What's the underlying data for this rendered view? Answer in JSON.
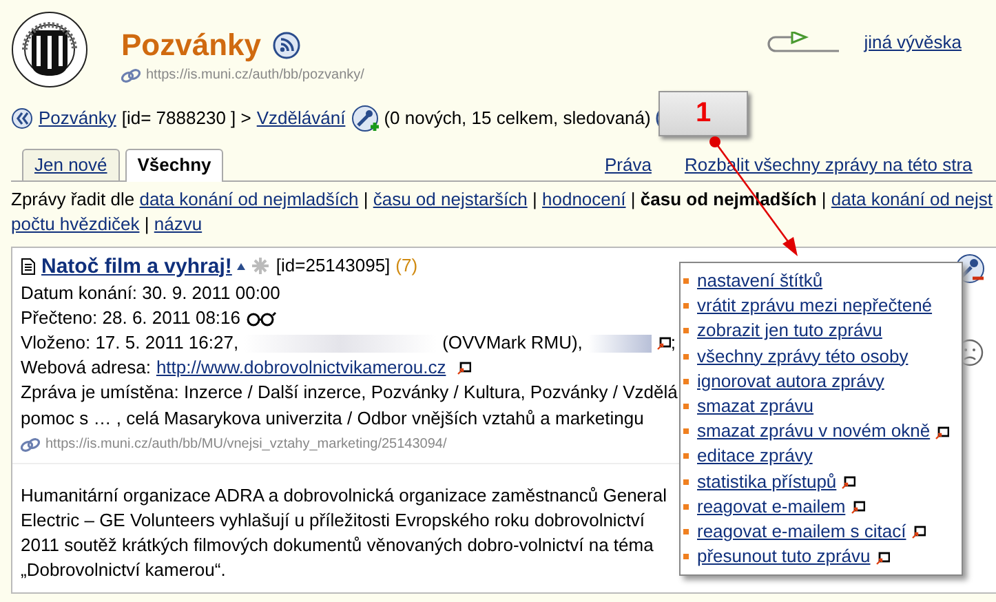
{
  "header": {
    "title": "Pozvánky",
    "url": "https://is.muni.cz/auth/bb/pozvanky/",
    "other_board_link": "jiná vývěska"
  },
  "breadcrumb": {
    "parent_link": "Pozvánky",
    "id_text": "[id= 7888230 ] >",
    "current_link": "Vzdělávání",
    "stats": "(0 nových, 15 celkem, sledovaná)"
  },
  "callout": {
    "number": "1"
  },
  "tabs": [
    {
      "label": "Jen nové",
      "selected": false
    },
    {
      "label": "Všechny",
      "selected": true
    }
  ],
  "top_links": [
    "Práva",
    "Rozbalit všechny zprávy na této stra"
  ],
  "sort": {
    "label": "Zprávy řadit dle",
    "separator": "|",
    "lines": [
      [
        {
          "label": "data konání od nejmladších",
          "selected": false
        },
        {
          "label": "času od nejstarších",
          "selected": false
        },
        {
          "label": "hodnocení",
          "selected": false
        },
        {
          "label": "času od nejmladších",
          "selected": true
        },
        {
          "label": "data konání od nejst",
          "selected": false
        }
      ],
      [
        {
          "label": "počtu hvězdiček",
          "selected": false
        },
        {
          "label": "názvu",
          "selected": false
        }
      ]
    ]
  },
  "message": {
    "title": "Natoč film a vyhraj!",
    "id": "[id=25143095]",
    "count": "(7)",
    "event_date": "Datum konání: 30. 9. 2011 00:00",
    "read": "Přečteno: 28. 6. 2011 08:16",
    "posted_prefix": "Vloženo: 17. 5. 2011 16:27,",
    "posted_org": "(OVVMark RMU),",
    "posted_suffix": ";",
    "web_label": "Webová adresa:",
    "web_link": "http://www.dobrovolnictvikamerou.cz",
    "placement_lines": [
      "Zpráva je umístěna: Inzerce / Další inzerce, Pozvánky / Kultura, Pozvánky / Vzdělá",
      "pomoc s … , celá Masarykova univerzita / Odbor vnějších vztahů a marketingu"
    ],
    "url": "https://is.muni.cz/auth/bb/MU/vnejsi_vztahy_marketing/25143094/",
    "body": "Humanitární organizace ADRA a dobrovolnická organizace zaměstnanců General Electric – GE Volunteers vyhlašují u příležitosti Evropského roku dobrovolnictví 2011 soutěž krátkých filmových dokumentů věnovaných dobro-volnictví na téma „Dobrovolnictví kamerou“."
  },
  "menu": [
    {
      "label": "nastavení štítků",
      "new_window": false
    },
    {
      "label": "vrátit zprávu mezi nepřečtené",
      "new_window": false
    },
    {
      "label": "zobrazit jen tuto zprávu",
      "new_window": false
    },
    {
      "label": "všechny zprávy této osoby",
      "new_window": false
    },
    {
      "label": "ignorovat autora zprávy",
      "new_window": false
    },
    {
      "label": "smazat zprávu",
      "new_window": false
    },
    {
      "label": "smazat zprávu v novém okně",
      "new_window": true
    },
    {
      "label": "editace zprávy",
      "new_window": false
    },
    {
      "label": "statistika přístupů",
      "new_window": true
    },
    {
      "label": "reagovat e-mailem",
      "new_window": true
    },
    {
      "label": "reagovat e-mailem s citací",
      "new_window": true
    },
    {
      "label": "přesunout tuto zprávu",
      "new_window": true
    }
  ]
}
